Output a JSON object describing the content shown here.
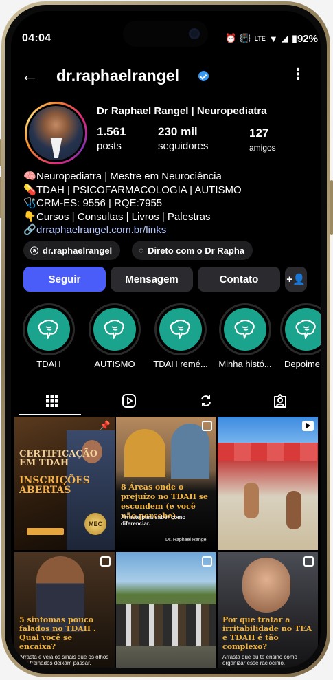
{
  "status_bar": {
    "time": "04:04",
    "battery": "92%"
  },
  "header": {
    "username": "dr.raphaelrangel"
  },
  "profile": {
    "display_name": "Dr Raphael Rangel | Neuropediatra",
    "stats": [
      {
        "value": "1.561",
        "label": "posts"
      },
      {
        "value": "230 mil",
        "label": "seguidores"
      },
      {
        "value": "127",
        "label": "amigos"
      }
    ],
    "bio": [
      {
        "icon": "brain-emoji",
        "glyph": "🧠",
        "text": "Neuropediatra | Mestre em Neurociência"
      },
      {
        "icon": "pill-emoji",
        "glyph": "💊",
        "text": "TDAH | PSICOFARMACOLOGIA | AUTISMO"
      },
      {
        "icon": "stethoscope-emoji",
        "glyph": "🩺",
        "text": "CRM-ES: 9556 | RQE:7955"
      },
      {
        "icon": "pointing-hand-emoji",
        "glyph": "👇",
        "text": "Cursos | Consultas | Livros | Palestras"
      }
    ],
    "link": "drraphaelrangel.com.br/links",
    "chips": [
      {
        "icon": "threads-icon",
        "label": "dr.raphaelrangel"
      },
      {
        "icon": "message-icon",
        "label": "Direto com o Dr Rapha"
      }
    ]
  },
  "actions": {
    "follow": "Seguir",
    "message": "Mensagem",
    "contact": "Contato"
  },
  "highlights": [
    {
      "label": "TDAH"
    },
    {
      "label": "AUTISMO"
    },
    {
      "label": "TDAH remé..."
    },
    {
      "label": "Minha histó..."
    },
    {
      "label": "Depoime"
    }
  ],
  "colors": {
    "accent": "#4a5df9",
    "highlight": "#1aa38d",
    "verified": "#3897f0"
  },
  "posts": [
    {
      "title": "CERTIFICAÇÃO EM TDAH",
      "subtitle": "INSCRIÇÕES ABERTAS",
      "badge": "MEC"
    },
    {
      "title": "8 Áreas onde o prejuízo no TDAH se escondem (e você não percebe).",
      "subtitle": "Arraste para saber como diferenciar.",
      "footer": "Dr. Raphael Rangel"
    },
    {
      "title": "",
      "subtitle": ""
    },
    {
      "title": "5 sintomas pouco falados no TDAH . Qual você se encaixa?",
      "subtitle": "Arrasta e veja os sinais que os olhos não treinados deixam passar."
    },
    {
      "title": "",
      "subtitle": ""
    },
    {
      "title": "Por que tratar a irritabilidade no TEA e TDAH é tão complexo?",
      "subtitle": "Arrasta que eu te ensino como organizar esse raciocínio."
    }
  ]
}
